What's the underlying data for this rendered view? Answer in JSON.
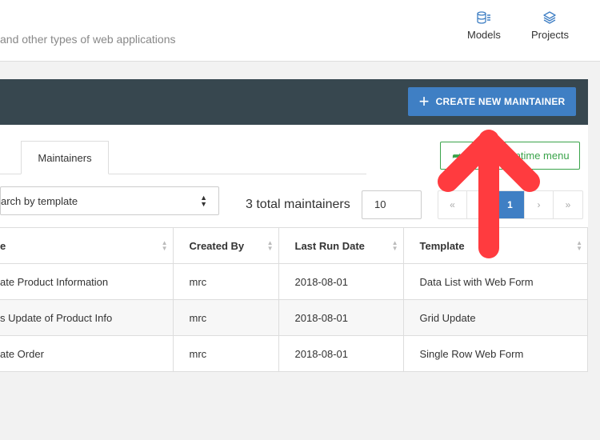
{
  "header": {
    "subtitle": "and other types of web applications",
    "nav": [
      {
        "label": "Models",
        "icon": "database-icon"
      },
      {
        "label": "Projects",
        "icon": "layers-icon"
      }
    ]
  },
  "panel": {
    "create_label": "CREATE NEW MAINTAINER",
    "tab": "Maintainers",
    "runtime_label": "Runtime menu",
    "runtime_visible": "untime menu",
    "search_placeholder": "arch by template",
    "total": "3 total maintainers",
    "page_size": "10",
    "pager": [
      "«",
      "‹",
      "1",
      "›",
      "»"
    ]
  },
  "table": {
    "columns": [
      "e",
      "Created By",
      "Last Run Date",
      "Template"
    ],
    "rows": [
      [
        "ate Product Information",
        "mrc",
        "2018-08-01",
        "Data List with Web Form"
      ],
      [
        "s Update of Product Info",
        "mrc",
        "2018-08-01",
        "Grid Update"
      ],
      [
        "ate Order",
        "mrc",
        "2018-08-01",
        "Single Row Web Form"
      ]
    ]
  },
  "colors": {
    "accent": "#3f7fc4",
    "header_bar": "#37474f",
    "green": "#3aa34a",
    "annotation_arrow": "#ff3b3f"
  }
}
